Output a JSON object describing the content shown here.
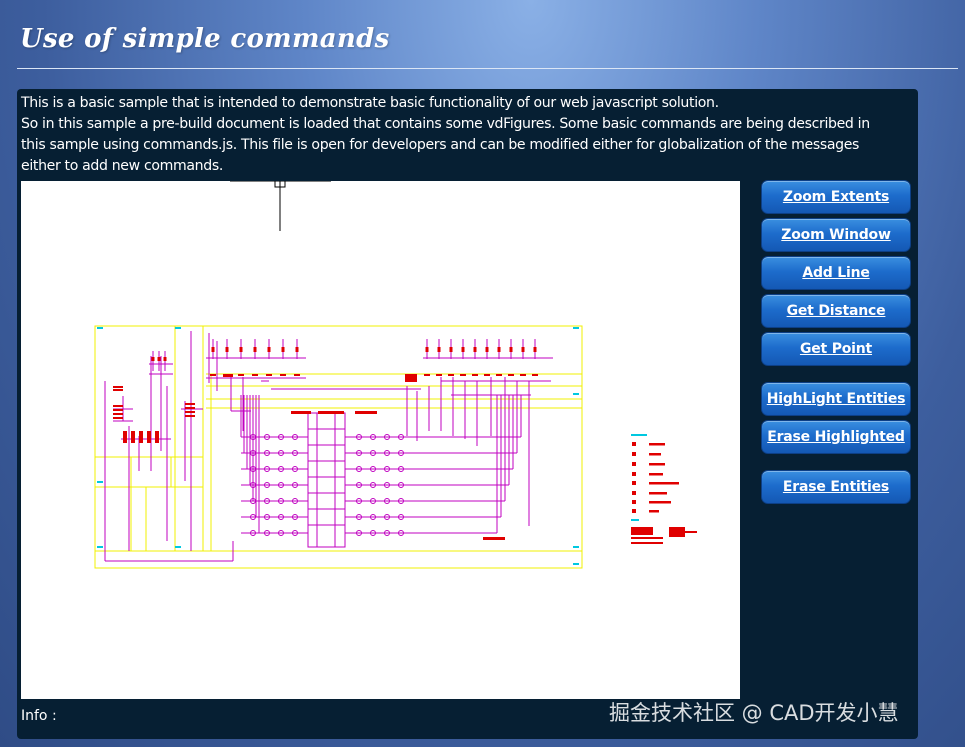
{
  "page": {
    "title": "Use of simple commands"
  },
  "description": {
    "lines": [
      "This is a basic sample that is intended to demonstrate basic functionality of our web javascript solution.",
      "So in this sample a pre-build document is loaded that contains some vdFigures. Some basic commands are being described in",
      "this sample using commands.js. This file is open for developers and can be modified either for globalization of the messages",
      "either to add new commands."
    ]
  },
  "commands": {
    "zoom_extents": "Zoom Extents",
    "zoom_window": "Zoom Window",
    "add_line": "Add Line",
    "get_distance": "Get Distance",
    "get_point": "Get Point",
    "highlight_entities": "HighLight Entities",
    "erase_highlighted": "Erase Highlighted",
    "erase_entities": "Erase Entities"
  },
  "status": {
    "info_label": "Info :"
  },
  "watermark": {
    "text": "掘金技术社区 @ CAD开发小慧"
  },
  "colors": {
    "background": "#4a6fb0",
    "panel": "#061f33",
    "button": "#1d6ccc",
    "drawing_yellow": "#f0f000",
    "drawing_magenta": "#c000c0",
    "drawing_red": "#e00000",
    "drawing_cyan": "#00c8e0"
  }
}
